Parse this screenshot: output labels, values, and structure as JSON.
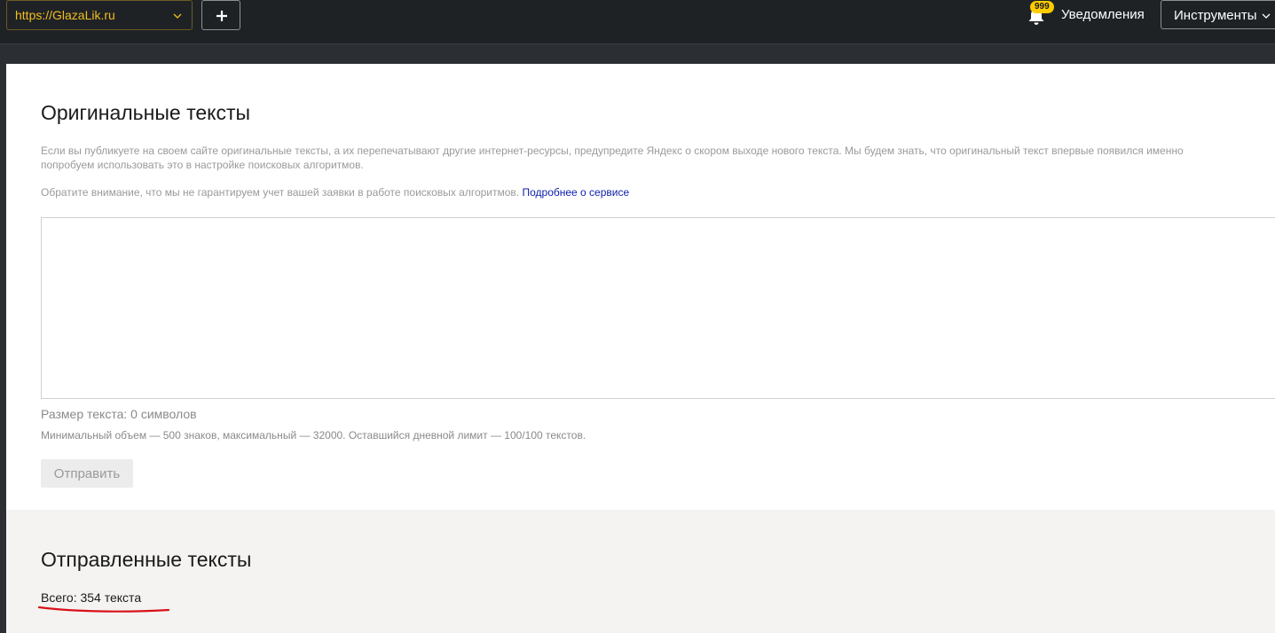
{
  "header": {
    "site_url": "https://GlazaLik.ru",
    "add_label": "+",
    "notifications_badge": "999",
    "notifications_label": "Уведомления",
    "tools_label": "Инструменты"
  },
  "original": {
    "title": "Оригинальные тексты",
    "description_line1": "Если вы публикуете на своем сайте оригинальные тексты, а их перепечатывают другие интернет-ресурсы, предупредите Яндекс о скором выходе нового текста. Мы будем знать, что оригинальный текст впервые появился именно",
    "description_line2": "попробуем использовать это в настройке поисковых алгоритмов.",
    "notice": "Обратите внимание, что мы не гарантируем учет вашей заявки в работе поисковых алгоритмов.",
    "more_link": "Подробнее о сервисе",
    "textarea_value": "",
    "size_label": "Размер текста: 0 символов",
    "limits": "Минимальный объем — 500 знаков, максимальный — 32000. Оставшийся дневной лимит — 100/100 текстов.",
    "submit_label": "Отправить"
  },
  "sent": {
    "title": "Отправленные тексты",
    "total": "Всего: 354 текста"
  },
  "colors": {
    "accent_yellow": "#f2bd21",
    "badge": "#ffcc00",
    "link": "#0c1fa8",
    "annotation_underline": "#d9121b"
  },
  "icons": {
    "site_dropdown": "chevron-down-icon",
    "add": "plus-icon",
    "notifications": "bell-icon",
    "tools_dropdown": "chevron-down-icon"
  }
}
